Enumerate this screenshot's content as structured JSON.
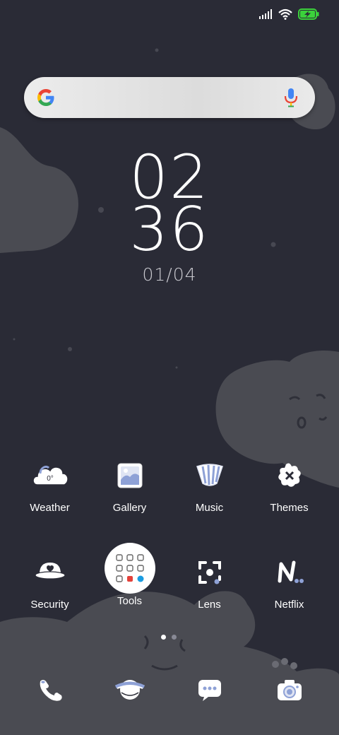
{
  "status_bar": {
    "signal_icon": "signal-bars-icon",
    "wifi_icon": "wifi-icon",
    "battery_icon": "battery-charging-icon",
    "battery_color": "#3bd23b"
  },
  "search": {
    "logo_icon": "google-g-icon",
    "mic_icon": "microphone-icon"
  },
  "clock": {
    "hours": "02",
    "minutes": "36",
    "date": "01/04"
  },
  "apps_row1": [
    {
      "label": "Weather",
      "icon": "weather-cloud-icon",
      "badge": "0°"
    },
    {
      "label": "Gallery",
      "icon": "gallery-picture-icon"
    },
    {
      "label": "Music",
      "icon": "music-striped-cup-icon"
    },
    {
      "label": "Themes",
      "icon": "themes-flower-icon"
    }
  ],
  "apps_row2": [
    {
      "label": "Security",
      "icon": "security-hat-icon"
    },
    {
      "label": "Tools",
      "icon": "tools-folder-icon"
    },
    {
      "label": "Lens",
      "icon": "lens-scan-icon"
    },
    {
      "label": "Netflix",
      "icon": "netflix-n-icon"
    }
  ],
  "page_indicator": {
    "total": 2,
    "active": 1
  },
  "dock": [
    {
      "icon": "phone-icon"
    },
    {
      "icon": "browser-planet-icon"
    },
    {
      "icon": "messages-bubble-icon"
    },
    {
      "icon": "camera-icon"
    }
  ],
  "colors": {
    "background": "#2a2b36",
    "cloud": "#4a4b52",
    "icon_fill": "#ffffff",
    "icon_accent": "#8ea1d6"
  }
}
